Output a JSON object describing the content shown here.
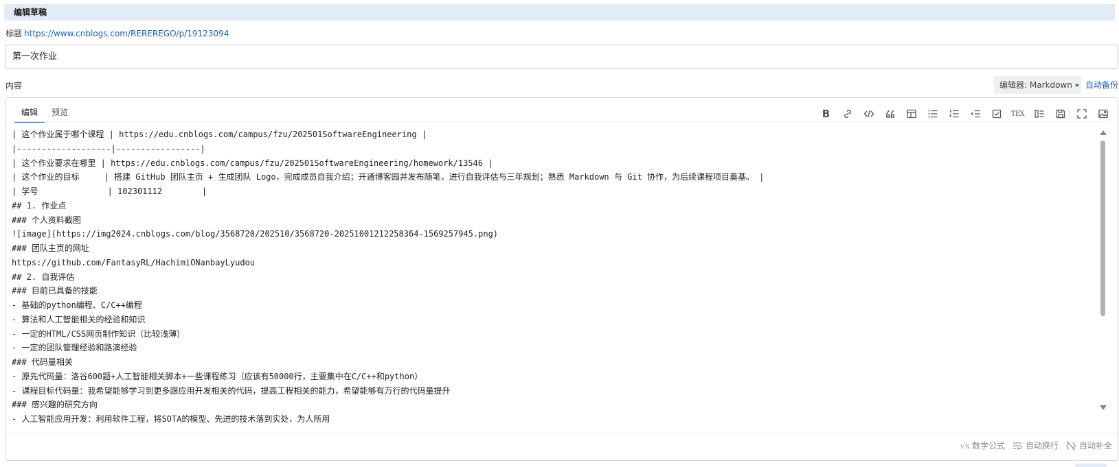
{
  "header": {
    "title": "编辑草稿"
  },
  "title_row": {
    "label": "标题",
    "link": "https://www.cnblogs.com/REREREGO/p/19123094"
  },
  "title_input": {
    "value": "第一次作业"
  },
  "content_label": "内容",
  "editor_select": {
    "label": "编辑器: Markdown"
  },
  "autosave": "自动备份",
  "tabs": [
    {
      "label": "编辑",
      "active": true
    },
    {
      "label": "预览",
      "active": false
    }
  ],
  "toolbar": {
    "icons": [
      "bold-icon",
      "link-icon",
      "code-icon",
      "quote-icon",
      "table-icon",
      "unordered-list-icon",
      "ordered-list-icon",
      "indent-icon",
      "checkbox-icon",
      "tex-icon",
      "toc-icon",
      "save-icon",
      "fullscreen-icon",
      "image-icon"
    ],
    "tex_label": "TEX"
  },
  "content_lines": [
    "| 这个作业属于哪个课程 | https://edu.cnblogs.com/campus/fzu/202501SoftwareEngineering |",
    "|-------------------|-----------------|",
    "| 这个作业要求在哪里 | https://edu.cnblogs.com/campus/fzu/202501SoftwareEngineering/homework/13546 |",
    "| 这个作业的目标     | 搭建 GitHub 团队主页 + 生成团队 Logo，完成成员自我介绍；开通博客园并发布随笔，进行自我评估与三年规划；熟悉 Markdown 与 Git 协作，为后续课程项目奠基。 |",
    "| 学号              | 102301112        |",
    "## 1. 作业点",
    "### 个人资料截图",
    "![image](https://img2024.cnblogs.com/blog/3568720/202510/3568720-20251001212258364-1569257945.png)",
    "### 团队主页的网址",
    "https://github.com/FantasyRL/HachimiONanbayLyudou",
    "## 2. 自我评估",
    "### 目前已具备的技能",
    "- 基础的python编程、C/C++编程",
    "- 算法和人工智能相关的经验和知识",
    "- 一定的HTML/CSS网页制作知识（比较浅薄）",
    "- 一定的团队管理经验和路演经验",
    "### 代码量相关",
    "- 原先代码量：洛谷600题+人工智能相关脚本+一些课程练习（应该有50000行，主要集中在C/C++和python）",
    "- 课程目标代码量：我希望能够学习到更多跟应用开发相关的代码，提高工程相关的能力，希望能够有万行的代码量提升",
    "### 感兴趣的研究方向",
    "- 人工智能应用开发：利用软件工程，将SOTA的模型、先进的技术落到实处，为人所用"
  ],
  "footer": {
    "math_label": "数学公式",
    "wrap_label": "自动换行",
    "complete_label": "自动补全"
  },
  "colors": {
    "header_bg": "#e3ebf6",
    "link": "#1a5fb4",
    "tab_underline": "#4a7cc9"
  }
}
